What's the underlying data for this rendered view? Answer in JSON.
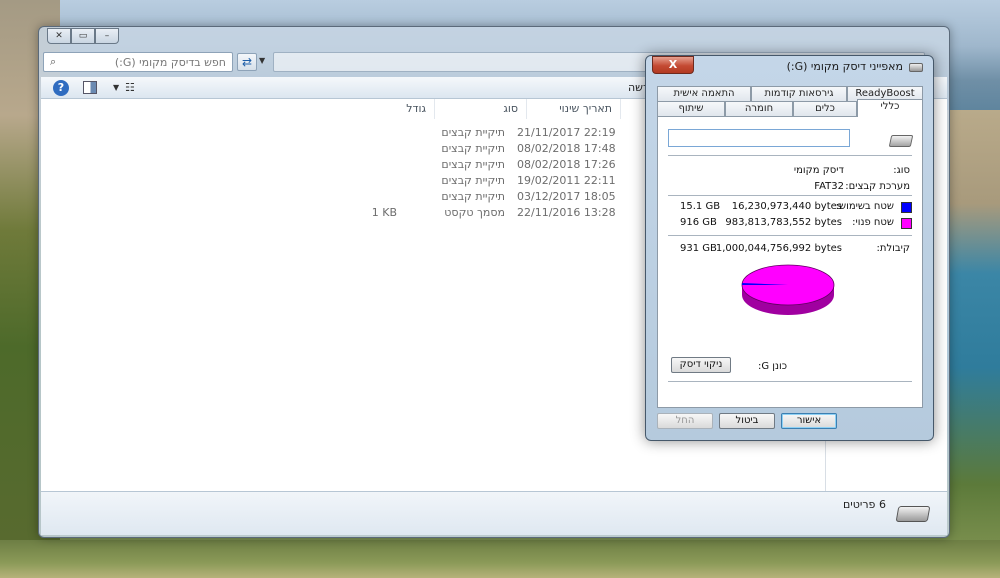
{
  "explorer": {
    "search_placeholder": "חפש בדיסק מקומי (G:)",
    "toolbar_label": "חדשה",
    "columns": {
      "date": "תאריך שינוי",
      "type": "סוג",
      "size": "גודל"
    },
    "files": [
      {
        "date": "21/11/2017 22:19",
        "type": "תיקיית קבצים",
        "size": ""
      },
      {
        "date": "08/02/2018 17:48",
        "type": "תיקיית קבצים",
        "size": ""
      },
      {
        "date": "08/02/2018 17:26",
        "type": "תיקיית קבצים",
        "size": ""
      },
      {
        "date": "19/02/2011 22:11",
        "type": "תיקיית קבצים",
        "size": ""
      },
      {
        "date": "03/12/2017 18:05",
        "type": "תיקיית קבצים",
        "size": ""
      },
      {
        "date": "22/11/2016 13:28",
        "type": "מסמך טקסט",
        "size": "1 KB"
      }
    ],
    "status_text": "6 פריטים"
  },
  "dialog": {
    "title": "מאפייני דיסק מקומי (G:)",
    "close_label": "X",
    "tabs_row1": [
      "ReadyBoost",
      "גירסאות קודמות",
      "התאמה אישית"
    ],
    "tabs_row2": [
      "כללי",
      "כלים",
      "חומרה",
      "שיתוף"
    ],
    "type_label": "סוג:",
    "type_value": "דיסק מקומי",
    "fs_label": "מערכת קבצים:",
    "fs_value": "FAT32",
    "used_label": "שטח בשימוש:",
    "used_bytes": "16,230,973,440 bytes",
    "used_gb": "15.1 GB",
    "free_label": "שטח פנוי:",
    "free_bytes": "983,813,783,552 bytes",
    "free_gb": "916 GB",
    "capacity_label": "קיבולת:",
    "capacity_bytes": "1,000,044,756,992 bytes",
    "capacity_gb": "931 GB",
    "drive_label": "כונן G:",
    "cleanup_button": "ניקוי דיסק",
    "ok_button": "אישור",
    "cancel_button": "ביטול",
    "apply_button": "החל",
    "used_fraction": 0.0162,
    "used_color": "#0000ff",
    "free_color": "#ff00ff"
  }
}
